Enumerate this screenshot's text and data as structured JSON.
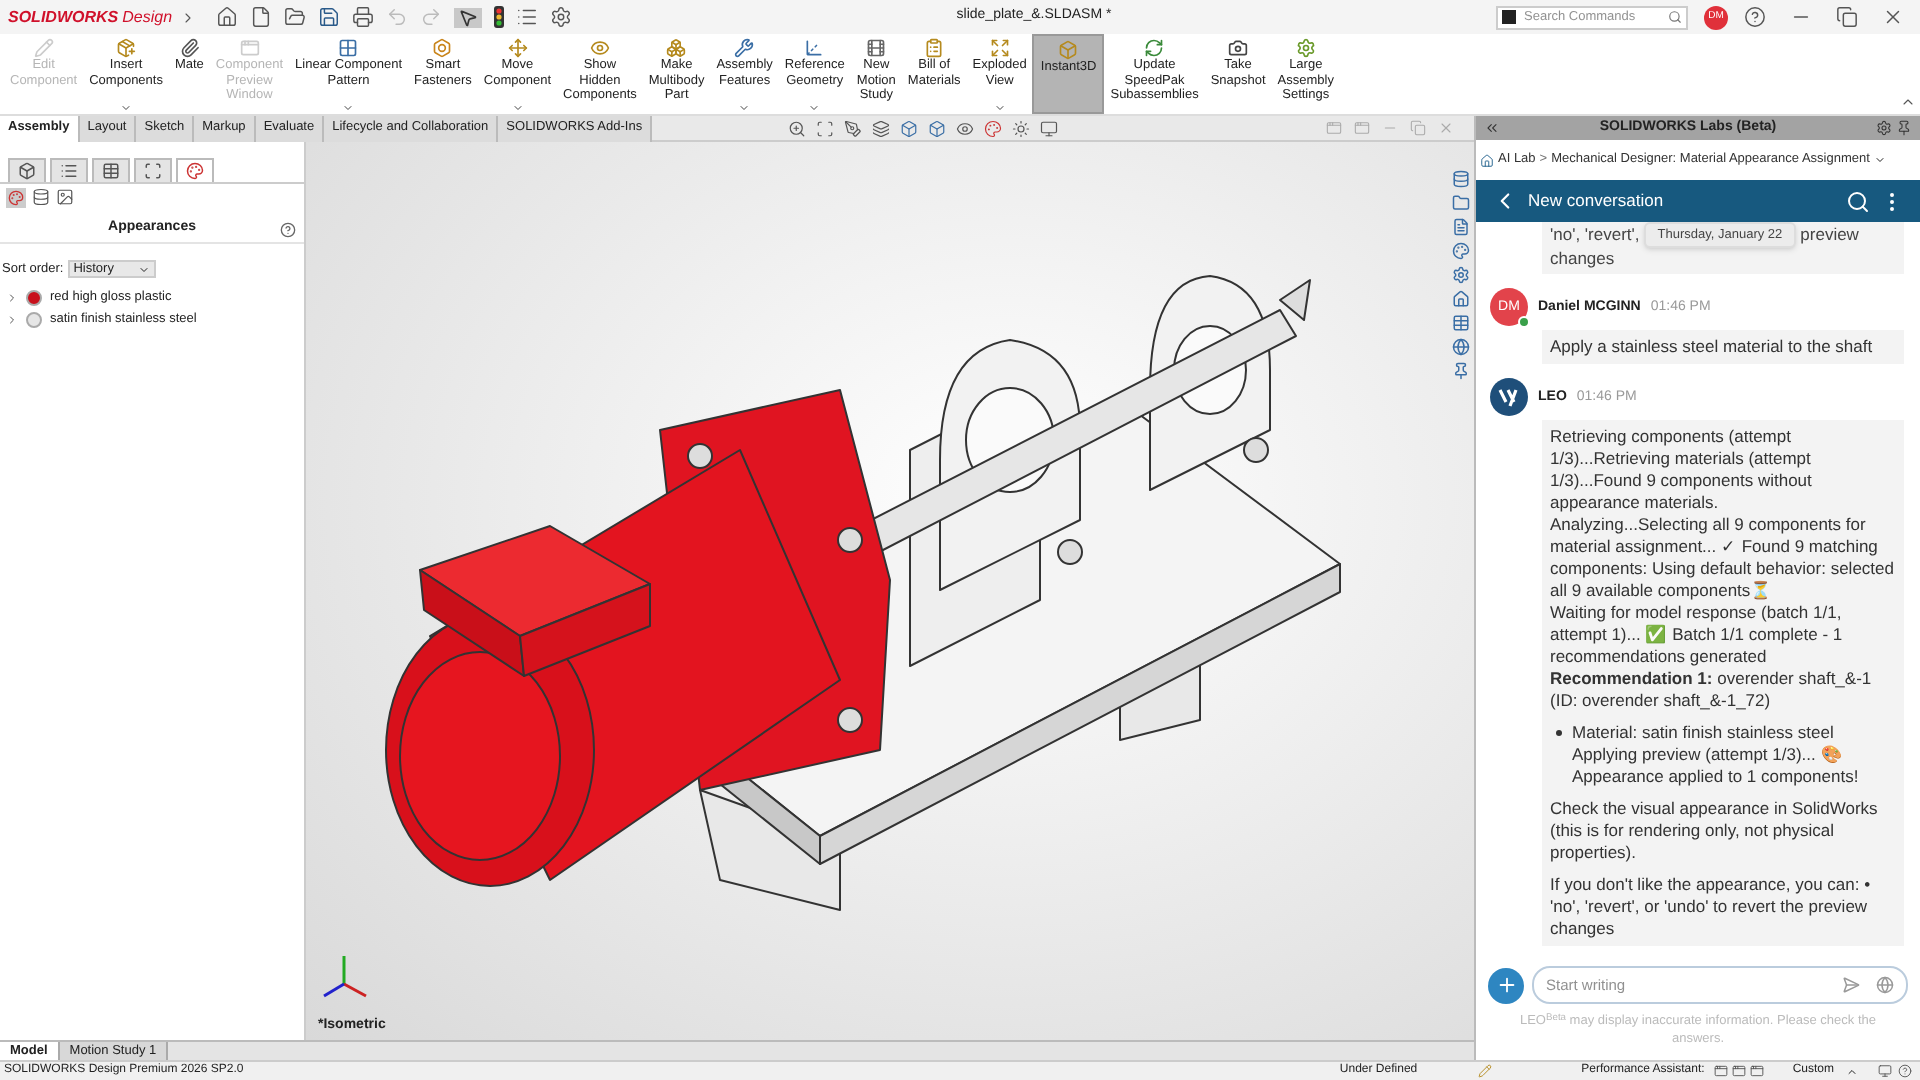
{
  "app": {
    "logo_brand": "SOLIDWORKS",
    "logo_product": "Design",
    "document_title": "slide_plate_&.SLDASM *",
    "search": {
      "placeholder": "Search Commands"
    },
    "user_initials": "DM"
  },
  "ribbon": [
    {
      "label": "Edit\nComponent",
      "disabled": true,
      "dropdown": false,
      "selected": false
    },
    {
      "label": "Insert\nComponents",
      "disabled": false,
      "dropdown": true,
      "selected": false
    },
    {
      "label": "Mate",
      "disabled": false,
      "dropdown": false,
      "selected": false
    },
    {
      "label": "Component\nPreview\nWindow",
      "disabled": true,
      "dropdown": false,
      "selected": false
    },
    {
      "label": "Linear Component\nPattern",
      "disabled": false,
      "dropdown": true,
      "selected": false
    },
    {
      "label": "Smart\nFasteners",
      "disabled": false,
      "dropdown": false,
      "selected": false
    },
    {
      "label": "Move\nComponent",
      "disabled": false,
      "dropdown": true,
      "selected": false
    },
    {
      "label": "Show\nHidden\nComponents",
      "disabled": false,
      "dropdown": false,
      "selected": false
    },
    {
      "label": "Make\nMultibody\nPart",
      "disabled": false,
      "dropdown": false,
      "selected": false
    },
    {
      "label": "Assembly\nFeatures",
      "disabled": false,
      "dropdown": true,
      "selected": false
    },
    {
      "label": "Reference\nGeometry",
      "disabled": false,
      "dropdown": true,
      "selected": false
    },
    {
      "label": "New\nMotion\nStudy",
      "disabled": false,
      "dropdown": false,
      "selected": false
    },
    {
      "label": "Bill of\nMaterials",
      "disabled": false,
      "dropdown": false,
      "selected": false
    },
    {
      "label": "Exploded\nView",
      "disabled": false,
      "dropdown": true,
      "selected": false
    },
    {
      "label": "Instant3D",
      "disabled": false,
      "dropdown": false,
      "selected": true
    },
    {
      "label": "Update\nSpeedPak\nSubassemblies",
      "disabled": false,
      "dropdown": false,
      "selected": false
    },
    {
      "label": "Take\nSnapshot",
      "disabled": false,
      "dropdown": false,
      "selected": false
    },
    {
      "label": "Large\nAssembly\nSettings",
      "disabled": false,
      "dropdown": false,
      "selected": false
    }
  ],
  "command_tabs": [
    {
      "label": "Assembly",
      "selected": true
    },
    {
      "label": "Layout",
      "selected": false
    },
    {
      "label": "Sketch",
      "selected": false
    },
    {
      "label": "Markup",
      "selected": false
    },
    {
      "label": "Evaluate",
      "selected": false
    },
    {
      "label": "Lifecycle and Collaboration",
      "selected": false
    },
    {
      "label": "SOLIDWORKS Add-Ins",
      "selected": false
    }
  ],
  "left_panel": {
    "title": "Appearances",
    "sort_label": "Sort order:",
    "sort_value": "History",
    "items": [
      {
        "label": "red high gloss plastic",
        "color": "#c8101c"
      },
      {
        "label": "satin finish stainless steel",
        "color": "#e6e6e6"
      }
    ]
  },
  "viewport": {
    "view_label": "*Isometric"
  },
  "bottom_tabs": [
    {
      "label": "Model",
      "selected": true
    },
    {
      "label": "Motion Study 1",
      "selected": false
    }
  ],
  "status_bar": {
    "product": "SOLIDWORKS Design Premium 2026 SP2.0",
    "state": "Under Defined",
    "assistant": "Performance Assistant:",
    "units": "Custom"
  },
  "chat_panel": {
    "title": "SOLIDWORKS Labs (Beta)",
    "breadcrumb": {
      "items": [
        "AI Lab",
        "Mechanical Designer: Material Appearance Assignment"
      ],
      "separator": ">"
    },
    "conversation_title": "New conversation",
    "date_badge": "Thursday, January 22",
    "previous_tail": {
      "left": "'no', 'revert',",
      "right": "preview",
      "last_line": "changes"
    },
    "messages": [
      {
        "kind": "user",
        "author": "Daniel MCGINN",
        "avatar": "DM",
        "time": "01:46 PM",
        "blocks": [
          {
            "kind": "text",
            "text": "Apply a stainless steel material to the shaft"
          }
        ]
      },
      {
        "kind": "bot",
        "author": "LEO",
        "time": "01:46 PM",
        "blocks": [
          {
            "kind": "text",
            "text": "Retrieving components (attempt 1/3)...Retrieving materials (attempt 1/3)...Found 9 components without appearance materials.\nAnalyzing...Selecting all 9 components for material assignment... ✓ Found 9 matching components: Using default behavior: selected all 9 available components⏳\nWaiting for model response (batch 1/1, attempt 1)... ✅ Batch 1/1 complete - 1 recommendations generated\n**Recommendation 1:** overender shaft_&-1 (ID: overender shaft_&-1_72)"
          },
          {
            "kind": "bullet",
            "text": "Material: satin finish stainless steel\nApplying preview (attempt 1/3)... 🎨\nAppearance applied to 1 components!"
          },
          {
            "kind": "text",
            "text": "Check the visual appearance in SolidWorks (this is for rendering only, not physical properties)."
          },
          {
            "kind": "text",
            "text": "If you don't like the appearance, you can: • 'no', 'revert', or 'undo' to revert the preview changes"
          }
        ]
      }
    ],
    "input": {
      "placeholder": "Start writing"
    },
    "disclaimer": "LEO$^{Beta}$ may display inaccurate information. Please check the answers."
  }
}
